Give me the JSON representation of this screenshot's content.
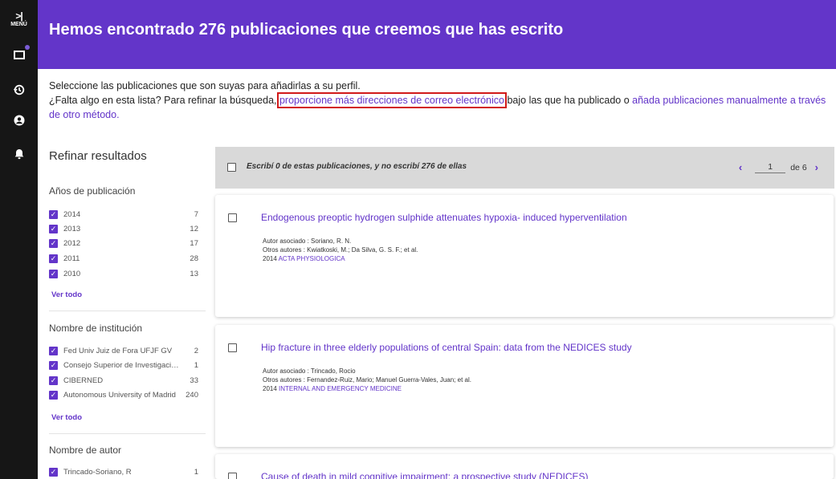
{
  "rail": {
    "menu_arrow": ">|",
    "menu_label": "MENÚ",
    "icons": [
      "folder-icon",
      "history-icon",
      "account-icon",
      "bell-icon"
    ]
  },
  "header": {
    "title": "Hemos encontrado 276 publicaciones que creemos que has escrito"
  },
  "intro": {
    "line1": "Seleccione las publicaciones que son suyas para añadirlas a su perfil.",
    "line2_before": "¿Falta algo en esta lista? Para refinar la búsqueda, ",
    "link_emails": "proporcione más direcciones de correo electrónico",
    "line2_middle": " bajo las que ha publicado o ",
    "link_manual": "añada publicaciones manualmente a través de otro método."
  },
  "sidebar": {
    "title": "Refinar resultados",
    "years": {
      "title": "Años de publicación",
      "items": [
        {
          "label": "2014",
          "count": "7"
        },
        {
          "label": "2013",
          "count": "12"
        },
        {
          "label": "2012",
          "count": "17"
        },
        {
          "label": "2011",
          "count": "28"
        },
        {
          "label": "2010",
          "count": "13"
        }
      ],
      "see_all": "Ver todo"
    },
    "institutions": {
      "title": "Nombre de institución",
      "items": [
        {
          "label": "Fed Univ Juiz de Fora UFJF GV",
          "count": "2"
        },
        {
          "label": "Consejo Superior de Investigaciones Científicas",
          "count": "1"
        },
        {
          "label": "CIBERNED",
          "count": "33"
        },
        {
          "label": "Autonomous University of Madrid",
          "count": "240"
        }
      ],
      "see_all": "Ver todo"
    },
    "authors": {
      "title": "Nombre de autor",
      "items": [
        {
          "label": "Trincado-Soriano, R",
          "count": "1"
        }
      ]
    }
  },
  "selection_bar": {
    "text": "Escribí 0 de estas publicaciones, y no escribí 276 de ellas",
    "prev": "‹",
    "page": "1",
    "of": "de 6",
    "next": "›"
  },
  "results": [
    {
      "title": "Endogenous preoptic hydrogen sulphide attenuates hypoxia- induced hyperventilation",
      "associated_author": "Autor asociado : Soriano, R. N.",
      "other_authors": "Otros autores : Kwiatkoski, M.; Da Silva, G. S. F.; et al.",
      "year": "2014",
      "journal": "ACTA PHYSIOLOGICA"
    },
    {
      "title": "Hip fracture in three elderly populations of central Spain: data from the NEDICES study",
      "associated_author": "Autor asociado : Trincado, Rocio",
      "other_authors": "Otros autores : Fernandez-Ruiz, Mario; Manuel Guerra-Vales, Juan; et al.",
      "year": "2014",
      "journal": "INTERNAL AND EMERGENCY MEDICINE"
    },
    {
      "title": "Cause of death in mild cognitive impairment: a prospective study (NEDICES)"
    }
  ]
}
